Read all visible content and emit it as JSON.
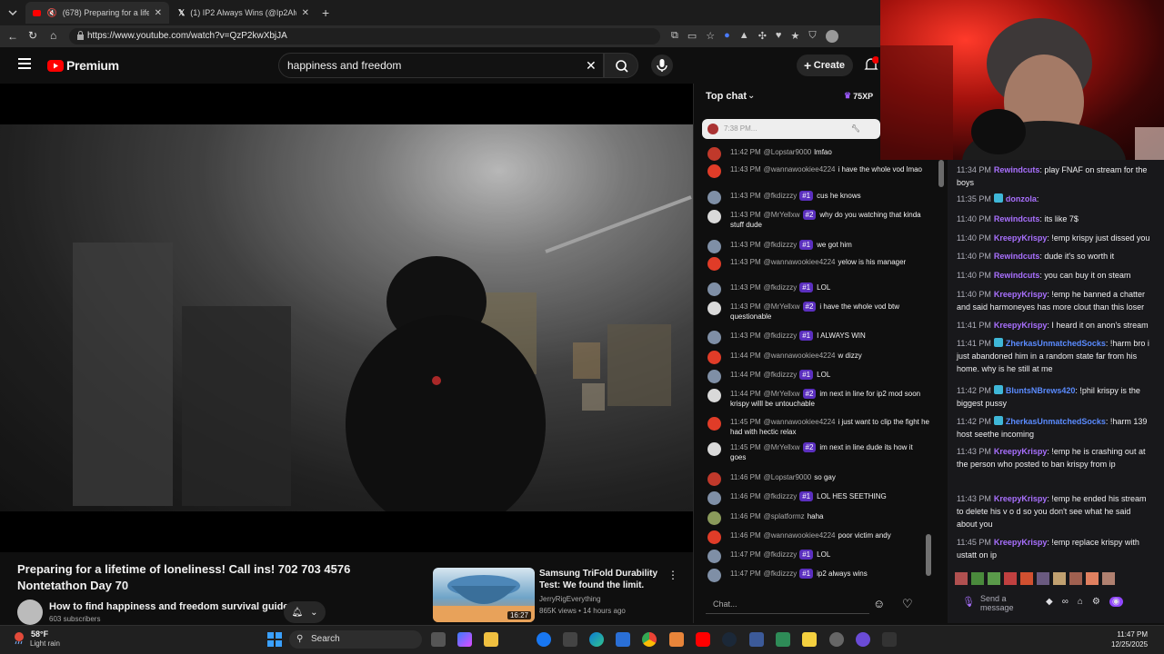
{
  "browser": {
    "tabs": [
      {
        "label": "(678) Preparing for a lifetime",
        "active": true
      },
      {
        "label": "(1) IP2 Always Wins (@Ip2AlwaysW",
        "active": false
      }
    ],
    "url": "https://www.youtube.com/watch?v=QzP2kwXbjJA"
  },
  "youtube": {
    "logo_text": "Premium",
    "search_value": "happiness and freedom",
    "create_label": "Create",
    "video": {
      "title": "Preparing for a lifetime of loneliness! Call ins! 702 703 4576 Nontetathon Day 70",
      "channel": "How to find happiness and freedom survival guide",
      "subscribers": "603 subscribers"
    },
    "recommended": {
      "title": "Samsung TriFold Durability Test: We found the limit.",
      "channel": "JerryRigEverything",
      "meta": "865K views • 14 hours ago",
      "duration": "16:27"
    }
  },
  "live_chat": {
    "header": "Top chat",
    "xp": "75XP",
    "pinned_time": "7:38 PM...",
    "input_placeholder": "Chat...",
    "messages": [
      {
        "time": "11:42 PM",
        "user": "@Lopstar9000",
        "badge": "",
        "text": "lmfao",
        "color": "#c0392b"
      },
      {
        "time": "11:43 PM",
        "user": "@wannawookiee4224",
        "badge": "",
        "text": "i have the whole vod lmao",
        "color": "#e03c28"
      },
      {
        "time": "11:43 PM",
        "user": "@fkdizzzy",
        "badge": "#1",
        "text": "cus he knows",
        "color": "#7f8fa6"
      },
      {
        "time": "11:43 PM",
        "user": "@MrYellxw",
        "badge": "#2",
        "text": "why do you watching that kinda stuff dude",
        "color": "#d9d9d9"
      },
      {
        "time": "11:43 PM",
        "user": "@fkdizzzy",
        "badge": "#1",
        "text": "we got him",
        "color": "#7f8fa6"
      },
      {
        "time": "11:43 PM",
        "user": "@wannawookiee4224",
        "badge": "",
        "text": "yelow is his manager",
        "color": "#e03c28"
      },
      {
        "time": "11:43 PM",
        "user": "@fkdizzzy",
        "badge": "#1",
        "text": "LOL",
        "color": "#7f8fa6"
      },
      {
        "time": "11:43 PM",
        "user": "@MrYellxw",
        "badge": "#2",
        "text": "i have the whole vod btw questionable",
        "color": "#d9d9d9"
      },
      {
        "time": "11:43 PM",
        "user": "@fkdizzzy",
        "badge": "#1",
        "text": "I ALWAYS WIN",
        "color": "#7f8fa6"
      },
      {
        "time": "11:44 PM",
        "user": "@wannawookiee4224",
        "badge": "",
        "text": "w dizzy",
        "color": "#e03c28"
      },
      {
        "time": "11:44 PM",
        "user": "@fkdizzzy",
        "badge": "#1",
        "text": "LOL",
        "color": "#7f8fa6"
      },
      {
        "time": "11:44 PM",
        "user": "@MrYellxw",
        "badge": "#2",
        "text": "im next in line for ip2 mod soon krispy willl be untouchable",
        "color": "#d9d9d9"
      },
      {
        "time": "11:45 PM",
        "user": "@wannawookiee4224",
        "badge": "",
        "text": "i just want to clip the fight he had with hectic relax",
        "color": "#e03c28"
      },
      {
        "time": "11:45 PM",
        "user": "@MrYellxw",
        "badge": "#2",
        "text": "im next in line dude its how it goes",
        "color": "#d9d9d9"
      },
      {
        "time": "11:46 PM",
        "user": "@Lopstar9000",
        "badge": "",
        "text": "so gay",
        "color": "#c0392b"
      },
      {
        "time": "11:46 PM",
        "user": "@fkdizzzy",
        "badge": "#1",
        "text": "LOL HES SEETHING",
        "color": "#7f8fa6"
      },
      {
        "time": "11:46 PM",
        "user": "@splatformz",
        "badge": "",
        "text": "haha",
        "color": "#8a9a5b"
      },
      {
        "time": "11:46 PM",
        "user": "@wannawookiee4224",
        "badge": "",
        "text": "poor victim andy",
        "color": "#e03c28"
      },
      {
        "time": "11:47 PM",
        "user": "@fkdizzzy",
        "badge": "#1",
        "text": "LOL",
        "color": "#7f8fa6"
      },
      {
        "time": "11:47 PM",
        "user": "@fkdizzzy",
        "badge": "#1",
        "text": "ip2 always wins",
        "color": "#7f8fa6"
      }
    ]
  },
  "twitch_chat": {
    "input_placeholder": "Send a message",
    "messages": [
      {
        "time": "11:34 PM",
        "user": "Rewindcuts",
        "style": "u",
        "badge": false,
        "text": ": play FNAF on stream for the boys"
      },
      {
        "time": "11:35 PM",
        "user": "donzola",
        "style": "u",
        "badge": true,
        "text": ":"
      },
      {
        "time": "11:40 PM",
        "user": "Rewindcuts",
        "style": "u",
        "badge": false,
        "text": ": its like 7$"
      },
      {
        "time": "11:40 PM",
        "user": "KreepyKrispy",
        "style": "u",
        "badge": false,
        "text": ": !emp krispy just dissed you"
      },
      {
        "time": "11:40 PM",
        "user": "Rewindcuts",
        "style": "u",
        "badge": false,
        "text": ": dude it's so worth it"
      },
      {
        "time": "11:40 PM",
        "user": "Rewindcuts",
        "style": "u",
        "badge": false,
        "text": ": you can buy it on steam"
      },
      {
        "time": "11:40 PM",
        "user": "KreepyKrispy",
        "style": "u",
        "badge": false,
        "text": ": !emp he banned a chatter and said harmoneyes has more clout than this loser"
      },
      {
        "time": "11:41 PM",
        "user": "KreepyKrispy",
        "style": "u",
        "badge": false,
        "text": ": I heard it on anon's stream"
      },
      {
        "time": "11:41 PM",
        "user": "ZherkasUnmatchedSocks",
        "style": "u2",
        "badge": true,
        "text": ": !harm bro i just abandoned him in a random state far from his home. why is he still at me"
      },
      {
        "time": "11:42 PM",
        "user": "BluntsNBrews420",
        "style": "u2",
        "badge": true,
        "text": ": !phil krispy is the biggest pussy"
      },
      {
        "time": "11:42 PM",
        "user": "ZherkasUnmatchedSocks",
        "style": "u2",
        "badge": true,
        "text": ": !harm 139 host seethe incoming"
      },
      {
        "time": "11:43 PM",
        "user": "KreepyKrispy",
        "style": "u",
        "badge": false,
        "text": ": !emp he is crashing out at the person who posted to ban krispy from ip"
      },
      {
        "time": "11:43 PM",
        "user": "KreepyKrispy",
        "style": "u",
        "badge": false,
        "text": ": !emp he ended his stream to delete his v o d so you don't see what he said about you"
      },
      {
        "time": "11:45 PM",
        "user": "KreepyKrispy",
        "style": "u",
        "badge": false,
        "text": ": !emp replace krispy with ustatt on ip"
      }
    ]
  },
  "taskbar": {
    "weather_temp": "58°F",
    "weather_desc": "Light rain",
    "search_label": "Search",
    "time": "11:47 PM",
    "date": "12/25/2025"
  }
}
